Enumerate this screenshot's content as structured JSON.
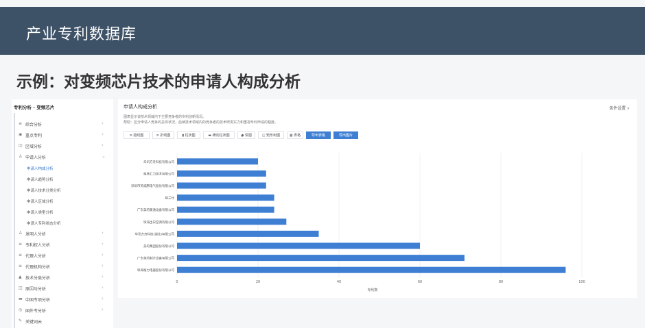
{
  "header": {
    "title": "产业专利数据库"
  },
  "subtitle": "示例：对变频芯片技术的申请人构成分析",
  "sidebar": {
    "title": "专利分析 - 变频芯片",
    "items": [
      {
        "icon": "≡",
        "label": "综合分析"
      },
      {
        "icon": "◉",
        "label": "重点专利"
      },
      {
        "icon": "◫",
        "label": "区域分析"
      },
      {
        "icon": "♙",
        "label": "申请人分析"
      },
      {
        "icon": "♙",
        "label": "发明人分析"
      },
      {
        "icon": "≡",
        "label": "专利权人分析"
      },
      {
        "icon": "≡",
        "label": "代理人分析"
      },
      {
        "icon": "≡",
        "label": "代理机构分析"
      },
      {
        "icon": "▲",
        "label": "技术分类分析"
      },
      {
        "icon": "◫",
        "label": "原因与分析"
      },
      {
        "icon": "▬",
        "label": "中国专项分析"
      },
      {
        "icon": "◎",
        "label": "国外专分析"
      },
      {
        "icon": "✎",
        "label": "关键词云"
      }
    ],
    "subitems": [
      "申请人构成分析",
      "申请人趋势分析",
      "申请人技术分类分析",
      "申请人区域分析",
      "申请人类型分析",
      "申请人专利状态分析"
    ]
  },
  "main": {
    "title": "申请人构成分析",
    "desc1": "图表显示该技术领域内下主要竞争者的专利创新情况。",
    "desc2": "帮助：区分申请人竞争的总体状况，后续技术领域内的竞争者的技术研发实力和重视专利申请的程度。",
    "condition": "条件设置 »",
    "toolbar": [
      "≡ 趋线图",
      "≡ 折线图",
      "▮ 柱状图",
      "▬ 横向柱状图",
      "◕ 饼图",
      "◫ 矩形树图",
      "▦ 表格",
      "导出表格",
      "导出图片"
    ]
  },
  "chart_data": {
    "type": "bar",
    "orientation": "horizontal",
    "categories": [
      "华讯方舟科技有限公司",
      "格林汇力技术有限公司",
      "深圳市英威腾电气股份有限公司",
      "格兰仕",
      "广东美的暖通设备有限公司",
      "珠海出日空调有限公司",
      "华讯方舟科技(湖北)有限公司",
      "美的集团股份有限公司",
      "广东美的制冷设备有限公司",
      "珠海格力电器股份有限公司"
    ],
    "values": [
      20,
      22,
      22,
      24,
      24,
      27,
      35,
      60,
      71,
      96
    ],
    "xlabel": "专利数",
    "xticks": [
      0,
      20,
      40,
      60,
      80,
      100
    ],
    "xlim": [
      0,
      100
    ],
    "color": "#3e7fd4",
    "grid": true
  }
}
